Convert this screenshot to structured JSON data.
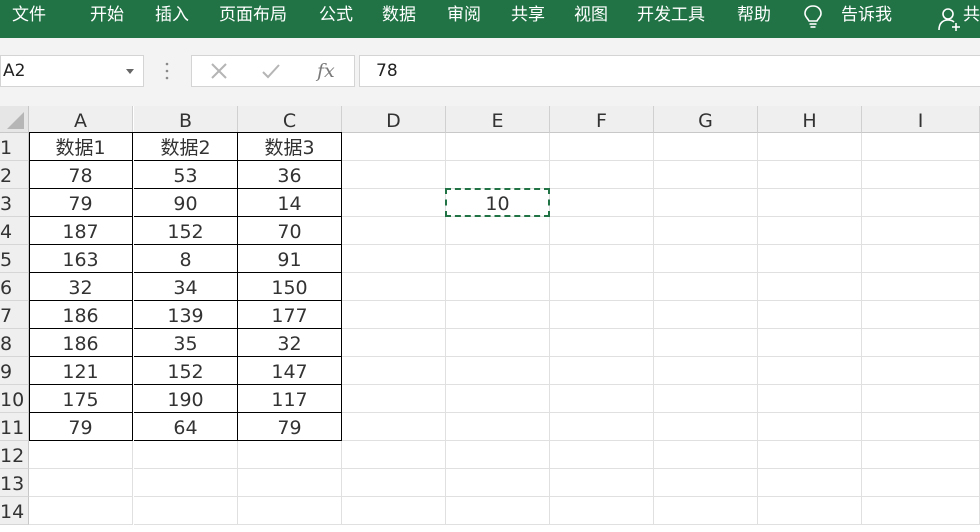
{
  "ribbon": {
    "tabs": [
      {
        "id": "file",
        "label": "文件"
      },
      {
        "id": "home",
        "label": "开始"
      },
      {
        "id": "insert",
        "label": "插入"
      },
      {
        "id": "layout",
        "label": "页面布局"
      },
      {
        "id": "formulas",
        "label": "公式"
      },
      {
        "id": "data",
        "label": "数据"
      },
      {
        "id": "review",
        "label": "审阅"
      },
      {
        "id": "share",
        "label": "共享"
      },
      {
        "id": "view",
        "label": "视图"
      },
      {
        "id": "developer",
        "label": "开发工具"
      },
      {
        "id": "help",
        "label": "帮助"
      }
    ],
    "tell_me": "告诉我",
    "share_partial": "共"
  },
  "formula_bar": {
    "name_box": "A2",
    "fx_label": "fx",
    "formula": "78"
  },
  "grid": {
    "columns": [
      "A",
      "B",
      "C",
      "D",
      "E",
      "F",
      "G",
      "H",
      "I"
    ],
    "rows": [
      "1",
      "2",
      "3",
      "4",
      "5",
      "6",
      "7",
      "8",
      "9",
      "10",
      "11",
      "12",
      "13",
      "14"
    ],
    "table_headers": [
      "数据1",
      "数据2",
      "数据3"
    ],
    "table_rows": [
      [
        "78",
        "53",
        "36"
      ],
      [
        "79",
        "90",
        "14"
      ],
      [
        "187",
        "152",
        "70"
      ],
      [
        "163",
        "8",
        "91"
      ],
      [
        "32",
        "34",
        "150"
      ],
      [
        "186",
        "139",
        "177"
      ],
      [
        "186",
        "35",
        "32"
      ],
      [
        "121",
        "152",
        "147"
      ],
      [
        "175",
        "190",
        "117"
      ],
      [
        "79",
        "64",
        "79"
      ]
    ],
    "copy_cell_ref": "E3",
    "copy_cell_value": "10"
  },
  "colors": {
    "ribbon": "#217346",
    "marquee": "#217346"
  }
}
